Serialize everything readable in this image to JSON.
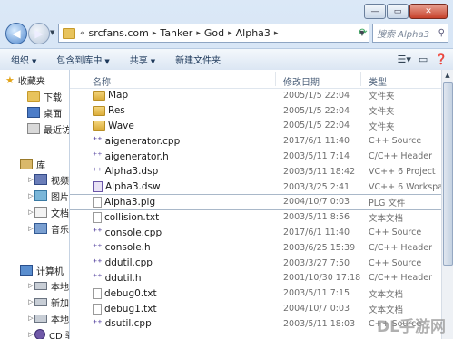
{
  "window": {
    "title_buttons": [
      "—",
      "▭",
      "✕"
    ]
  },
  "nav": {
    "back_icon": "◀",
    "forward_icon": "▶",
    "breadcrumb_prefix": "«",
    "breadcrumb": [
      "srcfans.com",
      "Tanker",
      "God",
      "Alpha3"
    ],
    "search_placeholder": "搜索 Alpha3"
  },
  "toolbar": {
    "organize": "组织",
    "include_library": "包含到库中",
    "share": "共享",
    "new_folder": "新建文件夹"
  },
  "sidebar": {
    "favorites": "收藏夹",
    "downloads": "下载",
    "desktop": "桌面",
    "recent": "最近访",
    "libraries": "库",
    "videos": "视频",
    "pictures": "图片",
    "documents": "文档",
    "music": "音乐",
    "computer": "计算机",
    "drive1": "本地磁",
    "drive2": "新加卷",
    "drive3": "本地磁",
    "cd": "CD 驱"
  },
  "columns": {
    "name": "名称",
    "date": "修改日期",
    "type": "类型"
  },
  "files": [
    {
      "name": "Map",
      "date": "2005/1/5 22:04",
      "type": "文件夹",
      "icon": "folder"
    },
    {
      "name": "Res",
      "date": "2005/1/5 22:04",
      "type": "文件夹",
      "icon": "folder"
    },
    {
      "name": "Wave",
      "date": "2005/1/5 22:04",
      "type": "文件夹",
      "icon": "folder"
    },
    {
      "name": "aigenerator.cpp",
      "date": "2017/6/1 11:40",
      "type": "C++ Source",
      "icon": "cpp"
    },
    {
      "name": "aigenerator.h",
      "date": "2003/5/11 7:14",
      "type": "C/C++ Header",
      "icon": "h"
    },
    {
      "name": "Alpha3.dsp",
      "date": "2003/5/11 18:42",
      "type": "VC++ 6 Project",
      "icon": "dsp"
    },
    {
      "name": "Alpha3.dsw",
      "date": "2003/3/25 2:41",
      "type": "VC++ 6 Workspace",
      "icon": "dsw"
    },
    {
      "name": "Alpha3.plg",
      "date": "2004/10/7 0:03",
      "type": "PLG 文件",
      "icon": "txt"
    },
    {
      "name": "collision.txt",
      "date": "2003/5/11 8:56",
      "type": "文本文档",
      "icon": "txt"
    },
    {
      "name": "console.cpp",
      "date": "2017/6/1 11:40",
      "type": "C++ Source",
      "icon": "cpp"
    },
    {
      "name": "console.h",
      "date": "2003/6/25 15:39",
      "type": "C/C++ Header",
      "icon": "h"
    },
    {
      "name": "ddutil.cpp",
      "date": "2003/3/27 7:50",
      "type": "C++ Source",
      "icon": "cpp"
    },
    {
      "name": "ddutil.h",
      "date": "2001/10/30 17:18",
      "type": "C/C++ Header",
      "icon": "h"
    },
    {
      "name": "debug0.txt",
      "date": "2003/5/11 7:15",
      "type": "文本文档",
      "icon": "txt"
    },
    {
      "name": "debug1.txt",
      "date": "2004/10/7 0:03",
      "type": "文本文档",
      "icon": "txt"
    },
    {
      "name": "dsutil.cpp",
      "date": "2003/5/11 18:03",
      "type": "C++ Source",
      "icon": "cpp"
    }
  ],
  "watermark": "DL手游网"
}
